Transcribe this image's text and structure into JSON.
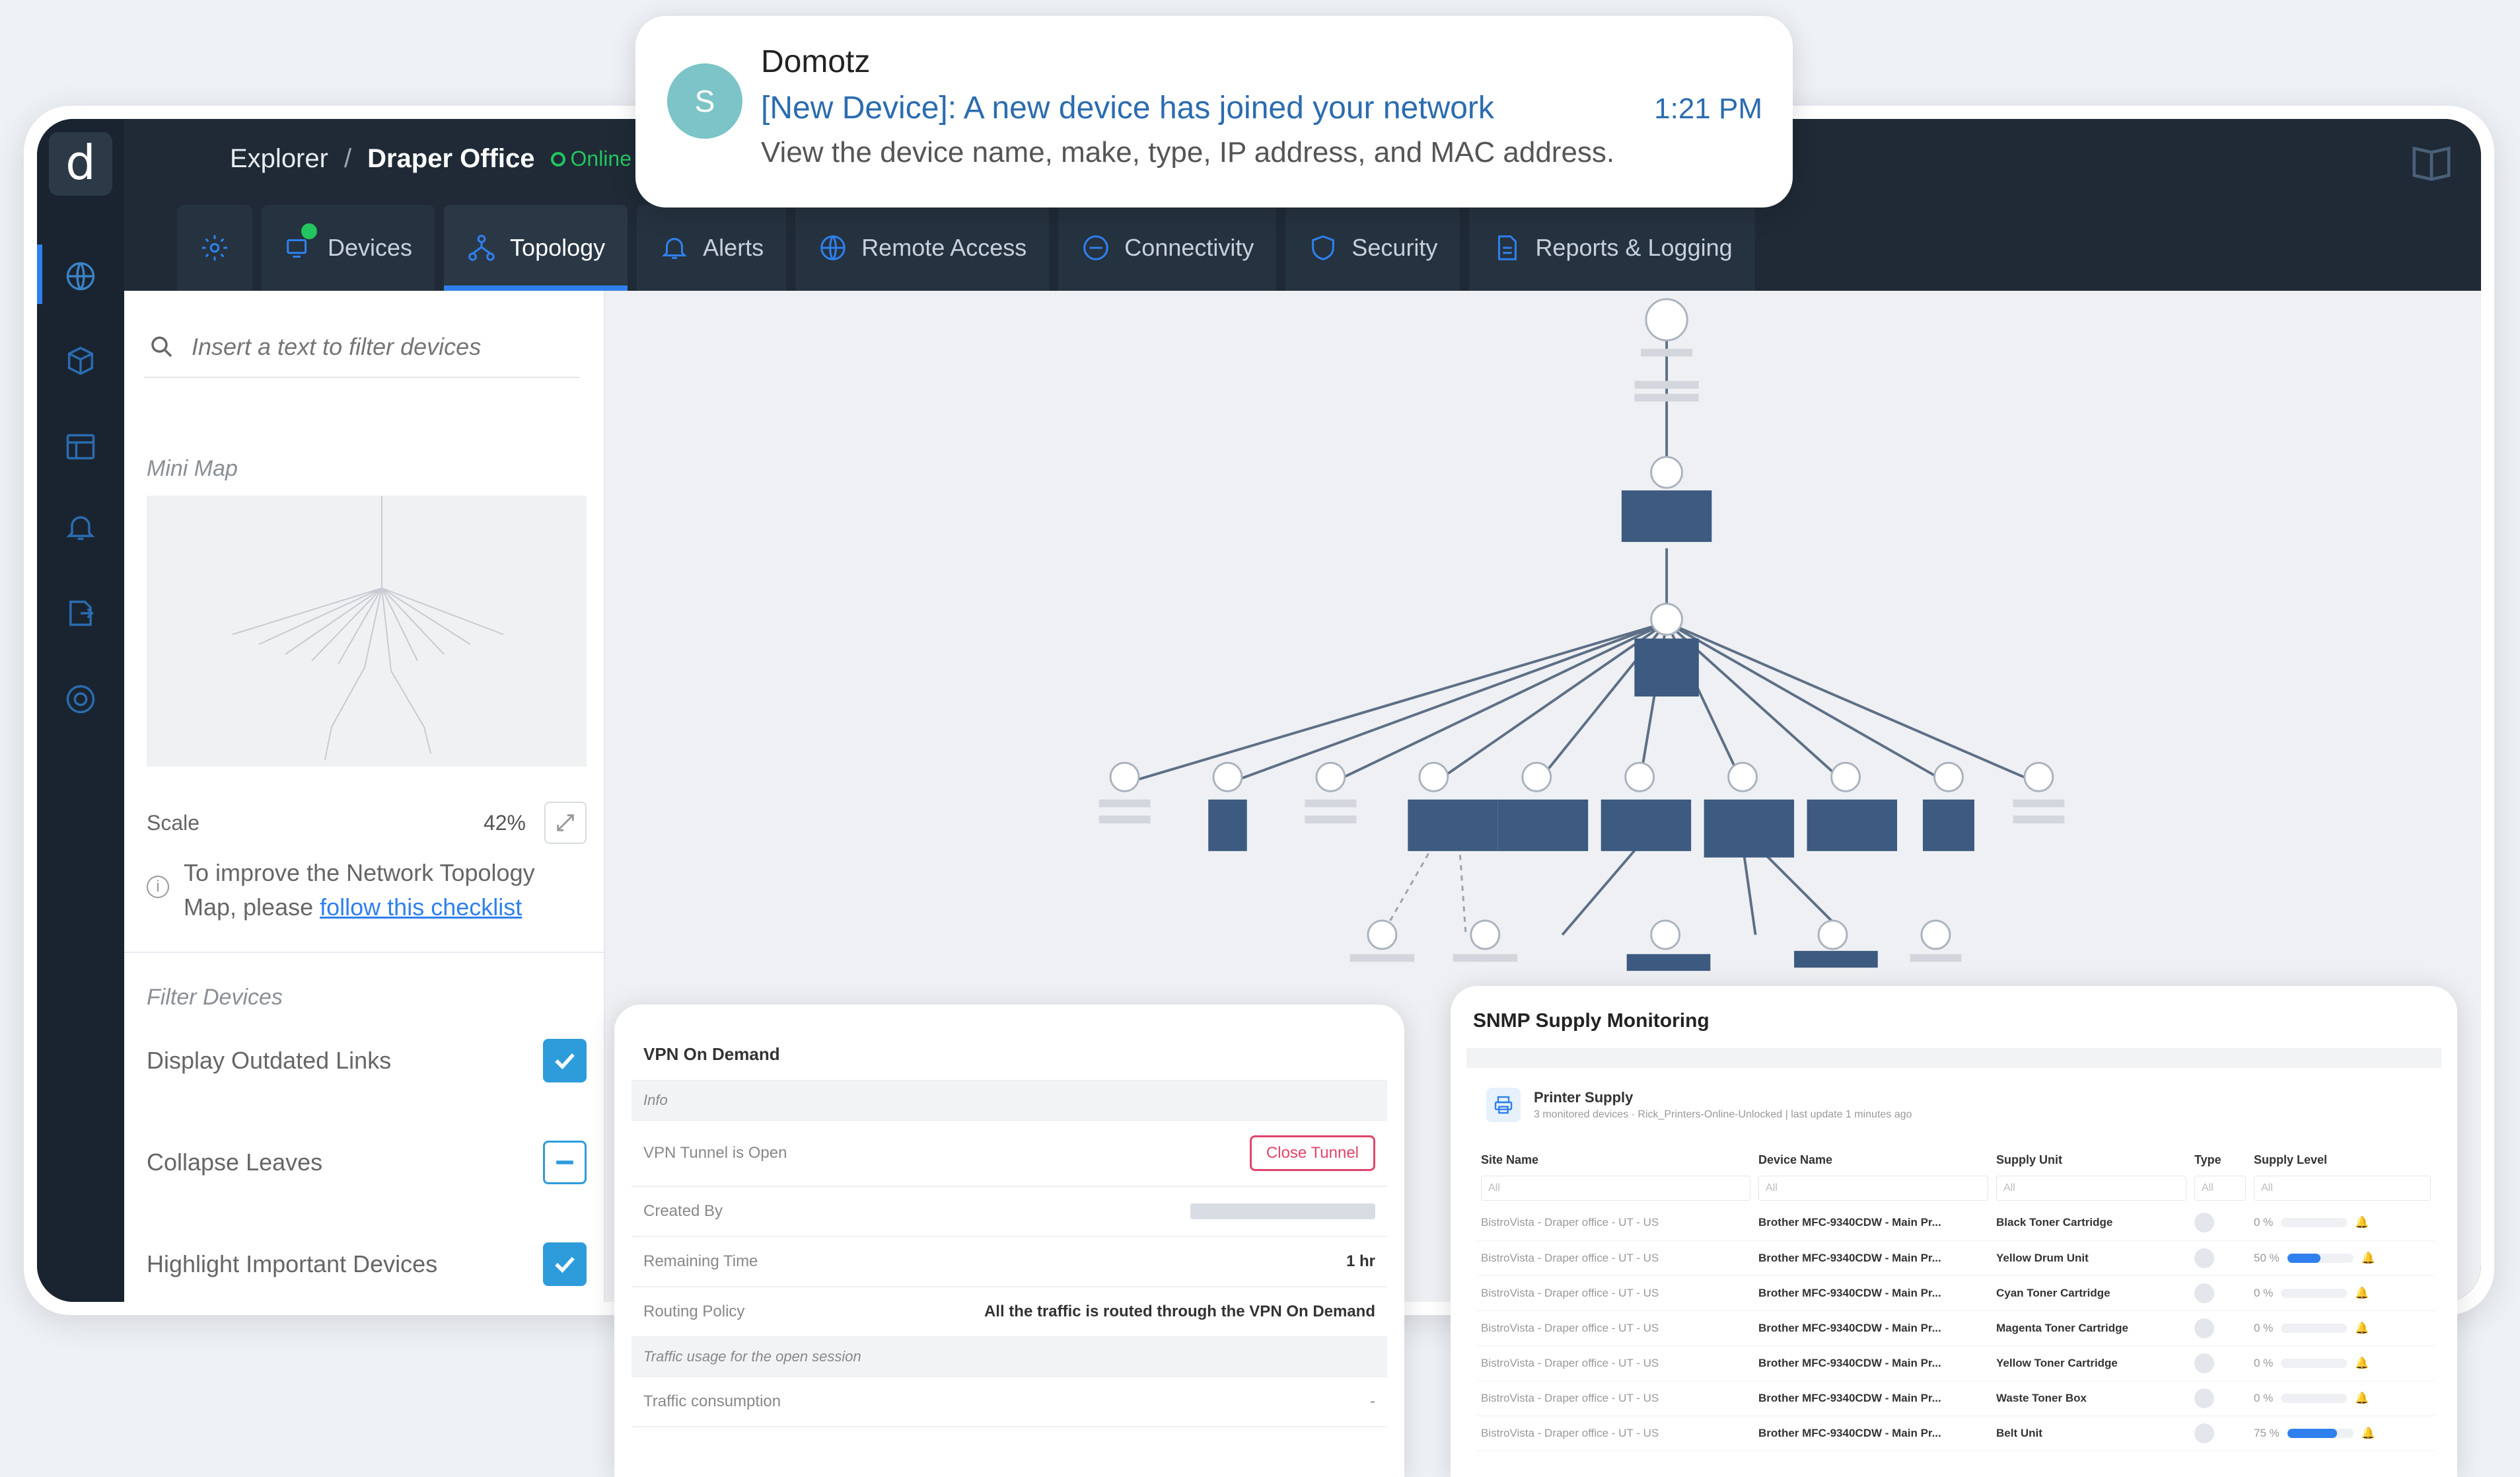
{
  "breadcrumb": {
    "root": "Explorer",
    "separator": "/",
    "current": "Draper Office",
    "status": "Online"
  },
  "tabs": [
    {
      "label": ""
    },
    {
      "label": "Devices"
    },
    {
      "label": "Topology"
    },
    {
      "label": "Alerts"
    },
    {
      "label": "Remote Access"
    },
    {
      "label": "Connectivity"
    },
    {
      "label": "Security"
    },
    {
      "label": "Reports & Logging"
    }
  ],
  "panel": {
    "search_placeholder": "Insert a text to filter devices",
    "minimap_label": "Mini Map",
    "scale_label": "Scale",
    "scale_value": "42%",
    "tip_text": "To improve the Network Topology Map, please ",
    "tip_link": "follow this checklist",
    "filter_label": "Filter Devices",
    "filters": [
      {
        "label": "Display Outdated Links",
        "state": "checked"
      },
      {
        "label": "Collapse Leaves",
        "state": "indeterminate"
      },
      {
        "label": "Highlight Important Devices",
        "state": "checked"
      }
    ]
  },
  "notification": {
    "avatar": "S",
    "app": "Domotz",
    "title": "[New Device]: A new device has joined your network",
    "time": "1:21 PM",
    "body": "View the device name, make, type, IP address, and MAC address."
  },
  "vpn": {
    "title": "VPN On Demand",
    "info_label": "Info",
    "tunnel_status": "VPN Tunnel is Open",
    "close_button": "Close Tunnel",
    "created_by_label": "Created By",
    "remaining_label": "Remaining Time",
    "remaining_value": "1 hr",
    "routing_label": "Routing Policy",
    "routing_value": "All the traffic is routed through the VPN On Demand",
    "traffic_section": "Traffic usage for the open session",
    "traffic_label": "Traffic consumption",
    "traffic_value": "-"
  },
  "snmp": {
    "title": "SNMP Supply Monitoring",
    "group_title": "Printer Supply",
    "group_meta": "3 monitored devices · Rick_Printers-Online-Unlocked | last update 1 minutes ago",
    "columns": [
      "Site Name",
      "Device Name",
      "Supply Unit",
      "Type",
      "Supply Level"
    ],
    "filter_all": "All",
    "rows": [
      {
        "site": "BistroVista - Draper office - UT - US",
        "device": "Brother MFC-9340CDW - Main Pr...",
        "unit": "Black Toner Cartridge",
        "level": "0 %",
        "pct": 0
      },
      {
        "site": "BistroVista - Draper office - UT - US",
        "device": "Brother MFC-9340CDW - Main Pr...",
        "unit": "Yellow Drum Unit",
        "level": "50 %",
        "pct": 50
      },
      {
        "site": "BistroVista - Draper office - UT - US",
        "device": "Brother MFC-9340CDW - Main Pr...",
        "unit": "Cyan Toner Cartridge",
        "level": "0 %",
        "pct": 0
      },
      {
        "site": "BistroVista - Draper office - UT - US",
        "device": "Brother MFC-9340CDW - Main Pr...",
        "unit": "Magenta Toner Cartridge",
        "level": "0 %",
        "pct": 0
      },
      {
        "site": "BistroVista - Draper office - UT - US",
        "device": "Brother MFC-9340CDW - Main Pr...",
        "unit": "Yellow Toner Cartridge",
        "level": "0 %",
        "pct": 0
      },
      {
        "site": "BistroVista - Draper office - UT - US",
        "device": "Brother MFC-9340CDW - Main Pr...",
        "unit": "Waste Toner Box",
        "level": "0 %",
        "pct": 0
      },
      {
        "site": "BistroVista - Draper office - UT - US",
        "device": "Brother MFC-9340CDW - Main Pr...",
        "unit": "Belt Unit",
        "level": "75 %",
        "pct": 75
      }
    ]
  },
  "colors": {
    "accent": "#2f80ed",
    "online": "#22c55e",
    "close": "#e0456b"
  }
}
